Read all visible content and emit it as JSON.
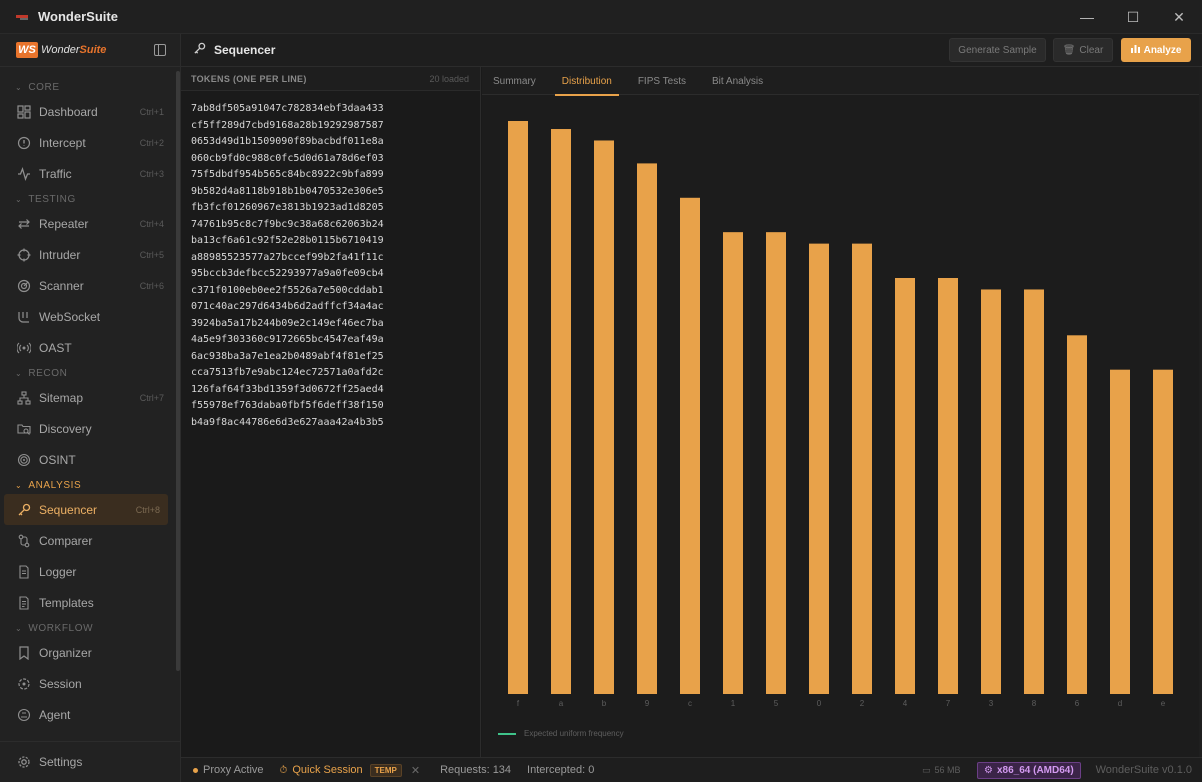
{
  "window": {
    "title": "WonderSuite",
    "controls": {
      "minimize": "—",
      "maximize": "☐",
      "close": "✕"
    }
  },
  "brand": {
    "mark": "WS",
    "text_a": "Wonder",
    "text_b": "Suite"
  },
  "sidebar": {
    "sections": [
      {
        "label": "CORE",
        "items": [
          {
            "label": "Dashboard",
            "shortcut": "Ctrl+1",
            "icon": "dashboard-icon"
          },
          {
            "label": "Intercept",
            "shortcut": "Ctrl+2",
            "icon": "shield-icon"
          },
          {
            "label": "Traffic",
            "shortcut": "Ctrl+3",
            "icon": "activity-icon"
          }
        ]
      },
      {
        "label": "TESTING",
        "items": [
          {
            "label": "Repeater",
            "shortcut": "Ctrl+4",
            "icon": "repeat-icon"
          },
          {
            "label": "Intruder",
            "shortcut": "Ctrl+5",
            "icon": "crosshair-icon"
          },
          {
            "label": "Scanner",
            "shortcut": "Ctrl+6",
            "icon": "radar-icon"
          },
          {
            "label": "WebSocket",
            "shortcut": "",
            "icon": "websocket-icon"
          },
          {
            "label": "OAST",
            "shortcut": "",
            "icon": "broadcast-icon"
          }
        ]
      },
      {
        "label": "RECON",
        "items": [
          {
            "label": "Sitemap",
            "shortcut": "Ctrl+7",
            "icon": "sitemap-icon"
          },
          {
            "label": "Discovery",
            "shortcut": "",
            "icon": "folder-search-icon"
          },
          {
            "label": "OSINT",
            "shortcut": "",
            "icon": "fingerprint-icon"
          }
        ]
      },
      {
        "label": "ANALYSIS",
        "items": [
          {
            "label": "Sequencer",
            "shortcut": "Ctrl+8",
            "icon": "key-icon",
            "active": true
          },
          {
            "label": "Comparer",
            "shortcut": "",
            "icon": "compare-icon"
          },
          {
            "label": "Logger",
            "shortcut": "",
            "icon": "logger-icon"
          },
          {
            "label": "Templates",
            "shortcut": "",
            "icon": "template-icon"
          }
        ]
      },
      {
        "label": "WORKFLOW",
        "items": [
          {
            "label": "Organizer",
            "shortcut": "",
            "icon": "bookmark-icon"
          },
          {
            "label": "Session",
            "shortcut": "",
            "icon": "session-icon"
          },
          {
            "label": "Agent",
            "shortcut": "",
            "icon": "agent-icon"
          }
        ]
      }
    ],
    "settings_label": "Settings"
  },
  "header": {
    "title": "Sequencer",
    "generate_label": "Generate Sample",
    "clear_label": "Clear",
    "analyze_label": "Analyze"
  },
  "tokens": {
    "heading": "TOKENS (ONE PER LINE)",
    "count": "20 loaded",
    "lines": [
      "7ab8df505a91047c782834ebf3daa433",
      "cf5ff289d7cbd9168a28b19292987587",
      "0653d49d1b1509090f89bacbdf011e8a",
      "060cb9fd0c988c0fc5d0d61a78d6ef03",
      "75f5dbdf954b565c84bc8922c9bfa899",
      "9b582d4a8118b918b1b0470532e306e5",
      "fb3fcf01260967e3813b1923ad1d8205",
      "74761b95c8c7f9bc9c38a68c62063b24",
      "ba13cf6a61c92f52e28b0115b6710419",
      "a88985523577a27bccef99b2fa41f11c",
      "95bccb3defbcc52293977a9a0fe09cb4",
      "c371f0100eb0ee2f5526a7e500cddab1",
      "071c40ac297d6434b6d2adffcf34a4ac",
      "3924ba5a17b244b09e2c149ef46ec7ba",
      "4a5e9f303360c9172665bc4547eaf49a",
      "6ac938ba3a7e1ea2b0489abf4f81ef25",
      "cca7513fb7e9abc124ec72571a0afd2c",
      "126faf64f33bd1359f3d0672ff25aed4",
      "f55978ef763daba0fbf5f6deff38f150",
      "b4a9f8ac44786e6d3e627aaa42a4b3b5"
    ]
  },
  "tabs": [
    "Summary",
    "Distribution",
    "FIPS Tests",
    "Bit Analysis"
  ],
  "active_tab": 1,
  "legend_label": "Expected uniform frequency",
  "chart_data": {
    "type": "bar",
    "categories": [
      "f",
      "a",
      "b",
      "9",
      "c",
      "1",
      "5",
      "0",
      "2",
      "4",
      "7",
      "3",
      "8",
      "6",
      "d",
      "e"
    ],
    "values": [
      50,
      49.3,
      48.3,
      46.3,
      43.3,
      40.3,
      40.3,
      39.3,
      39.3,
      36.3,
      36.3,
      35.3,
      35.3,
      31.3,
      28.3,
      28.3
    ],
    "ylim": [
      0,
      50
    ],
    "bar_color": "#e8a24a"
  },
  "status": {
    "proxy": "Proxy Active",
    "session": "Quick Session",
    "temp": "TEMP",
    "requests": "Requests: 134",
    "intercepted": "Intercepted: 0",
    "memory": "56 MB",
    "arch": "x86_64 (AMD64)",
    "version": "WonderSuite v0.1.0"
  }
}
